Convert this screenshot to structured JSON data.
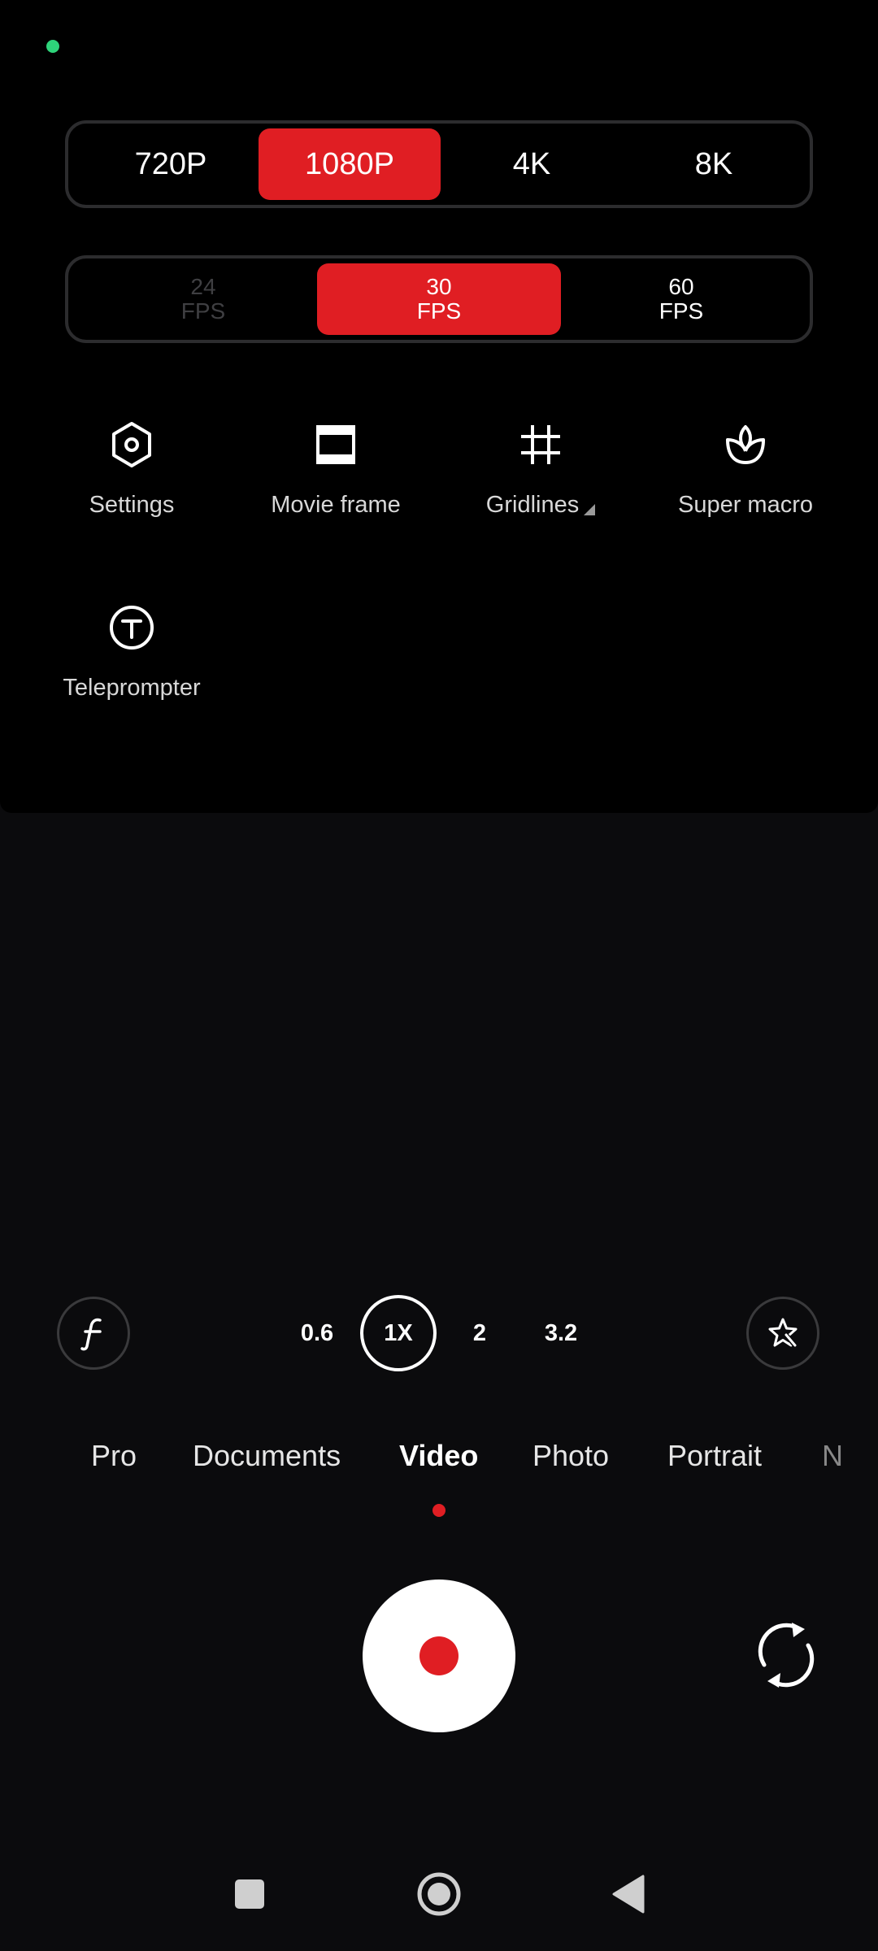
{
  "resolution": {
    "options": [
      "720P",
      "1080P",
      "4K",
      "8K"
    ],
    "selected": "1080P"
  },
  "fps": {
    "options": [
      {
        "value": "24",
        "unit": "FPS",
        "state": "disabled"
      },
      {
        "value": "30",
        "unit": "FPS",
        "state": "selected"
      },
      {
        "value": "60",
        "unit": "FPS",
        "state": "normal"
      }
    ]
  },
  "tools": {
    "settings": {
      "label": "Settings",
      "icon": "hexagon-gear-icon"
    },
    "movie_frame": {
      "label": "Movie frame",
      "icon": "movie-frame-icon"
    },
    "gridlines": {
      "label": "Gridlines",
      "icon": "grid-icon"
    },
    "super_macro": {
      "label": "Super macro",
      "icon": "flower-macro-icon"
    },
    "teleprompter": {
      "label": "Teleprompter",
      "icon": "teleprompter-icon"
    }
  },
  "zoom": {
    "options": [
      "0.6",
      "1X",
      "2",
      "3.2"
    ],
    "selected": "1X"
  },
  "modes": {
    "items": [
      "Pro",
      "Documents",
      "Video",
      "Photo",
      "Portrait",
      "N"
    ],
    "selected": "Video"
  },
  "colors": {
    "accent": "#e01e23",
    "status_dot": "#2ed47a",
    "background": "#000000"
  }
}
